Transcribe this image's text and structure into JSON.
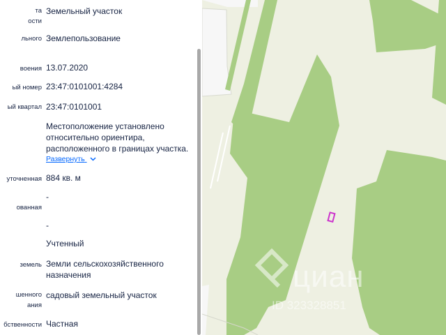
{
  "panel": {
    "rows": [
      {
        "label": "та\nости",
        "value": "Земельный участок"
      },
      {
        "label": "льного",
        "value": "Землепользование"
      },
      {
        "label": "воения",
        "value": "13.07.2020"
      },
      {
        "label": "ый номер",
        "value": "23:47:0101001:4284"
      },
      {
        "label": "ый квартал",
        "value": "23:47:0101001"
      },
      {
        "label": "",
        "value": "Местоположение установлено относительно ориентира, расположенного в границах участка."
      },
      {
        "label": "уточненная",
        "value": "884 кв. м"
      },
      {
        "label": "ованная",
        "value": "-"
      },
      {
        "label": "",
        "value": "-"
      },
      {
        "label": "",
        "value": "Учтенный"
      },
      {
        "label": "земель",
        "value": "Земли сельскохозяйственного назначения"
      },
      {
        "label": "шенного\nания",
        "value": "садовый земельный участок"
      },
      {
        "label": "бственности",
        "value": "Частная"
      }
    ],
    "expand_label": "Развернуть",
    "expand_icon": "chevron-down-icon"
  },
  "map": {
    "watermark_text": "циан",
    "watermark_id": "ID 323328851",
    "colors": {
      "background": "#eef0e2",
      "green": "#a8cd84",
      "white_area": "#f6f6f6",
      "marker": "#cc33cc"
    }
  }
}
